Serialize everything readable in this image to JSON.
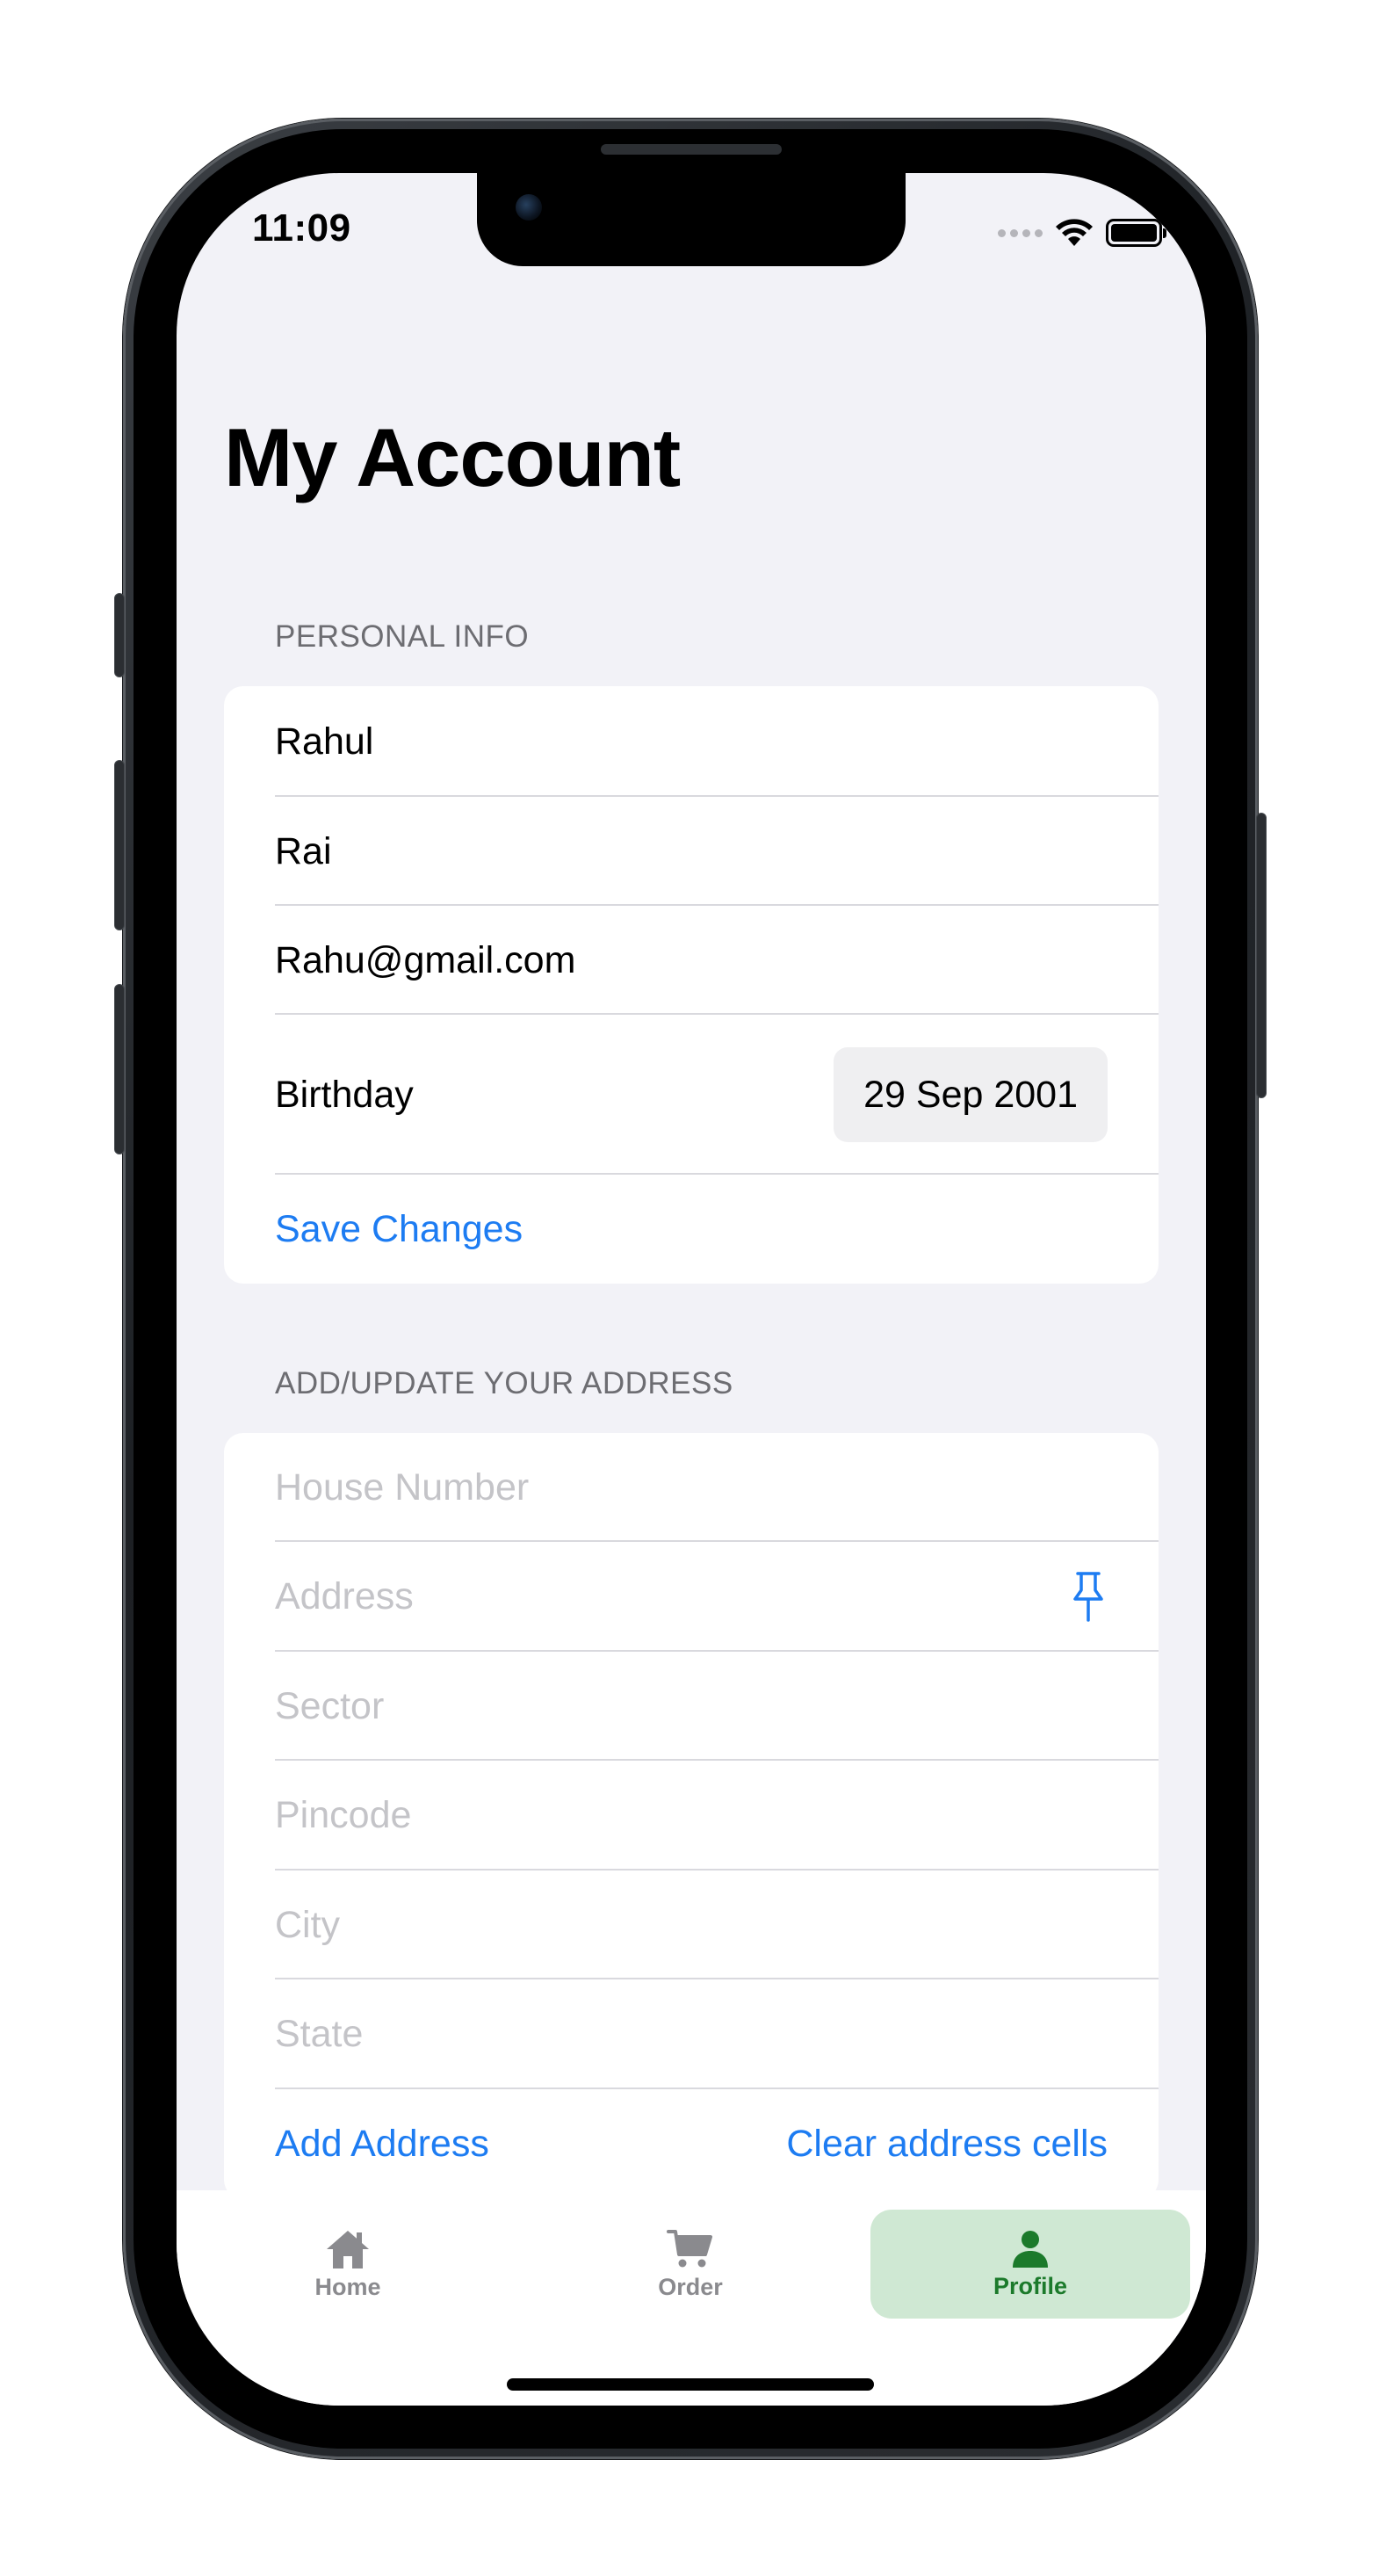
{
  "status_bar": {
    "time": "11:09"
  },
  "page": {
    "title": "My Account"
  },
  "personal_info": {
    "header": "PERSONAL INFO",
    "first_name": "Rahul",
    "last_name": "Rai",
    "email": "Rahu@gmail.com",
    "birthday_label": "Birthday",
    "birthday_value": "29 Sep 2001",
    "save_label": "Save Changes"
  },
  "address": {
    "header": "ADD/UPDATE YOUR ADDRESS",
    "house_number_placeholder": "House Number",
    "address_placeholder": "Address",
    "sector_placeholder": "Sector",
    "pincode_placeholder": "Pincode",
    "city_placeholder": "City",
    "state_placeholder": "State",
    "add_label": "Add Address",
    "clear_label": "Clear address cells",
    "pin_icon": "pushpin-icon"
  },
  "tabbar": {
    "items": [
      {
        "label": "Home",
        "icon": "house-icon",
        "selected": false
      },
      {
        "label": "Order",
        "icon": "cart-icon",
        "selected": false
      },
      {
        "label": "Profile",
        "icon": "person-icon",
        "selected": true
      }
    ]
  },
  "colors": {
    "accent": "#1d7cf2",
    "background": "#f2f2f7",
    "selected_tab_bg": "#cfe8d3",
    "selected_tab_fg": "#1c7a2b",
    "placeholder": "#c4c4c8"
  }
}
